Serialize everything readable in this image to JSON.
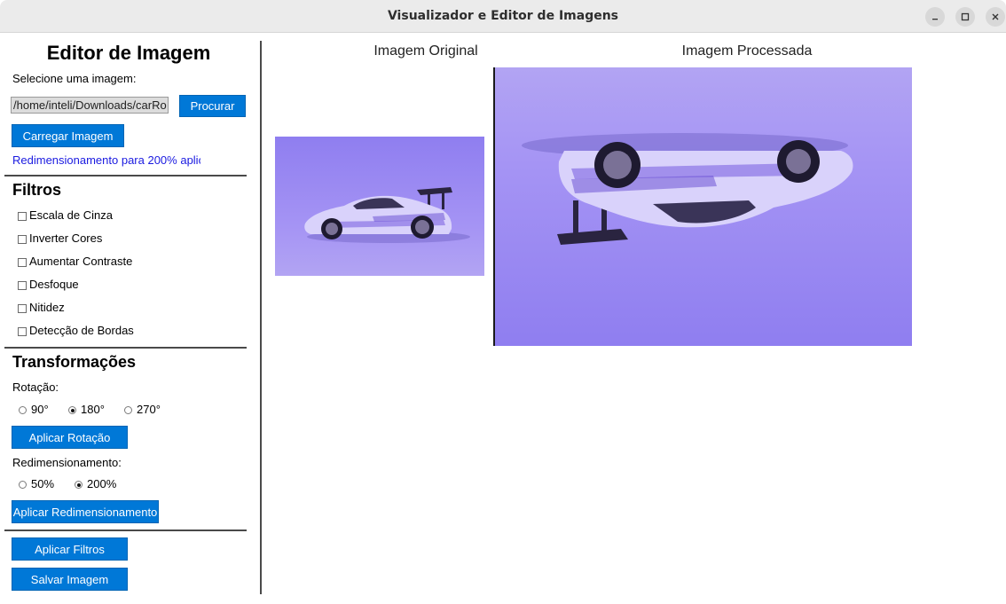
{
  "window": {
    "title": "Visualizador e Editor de Imagens"
  },
  "sidebar": {
    "heading": "Editor de Imagem",
    "select_label": "Selecione uma imagem:",
    "path_value": "/home/inteli/Downloads/carRo",
    "browse_label": "Procurar",
    "load_label": "Carregar Imagem",
    "status_text": "Redimensionamento para 200% aplic",
    "filters": {
      "heading": "Filtros",
      "items": [
        {
          "label": "Escala de Cinza",
          "checked": false
        },
        {
          "label": "Inverter Cores",
          "checked": false
        },
        {
          "label": "Aumentar Contraste",
          "checked": false
        },
        {
          "label": "Desfoque",
          "checked": false
        },
        {
          "label": "Nitidez",
          "checked": false
        },
        {
          "label": "Detecção de Bordas",
          "checked": false
        }
      ]
    },
    "transforms": {
      "heading": "Transformações",
      "rotation_label": "Rotação:",
      "rotation_options": [
        {
          "label": "90°",
          "selected": false
        },
        {
          "label": "180°",
          "selected": true
        },
        {
          "label": "270°",
          "selected": false
        }
      ],
      "apply_rotation_label": "Aplicar Rotação",
      "resize_label": "Redimensionamento:",
      "resize_options": [
        {
          "label": "50%",
          "selected": false
        },
        {
          "label": "200%",
          "selected": true
        }
      ],
      "apply_resize_label": "Aplicar Redimensionamento"
    },
    "apply_filters_label": "Aplicar Filtros",
    "save_label": "Salvar Imagem"
  },
  "viewer": {
    "original_label": "Imagem Original",
    "processed_label": "Imagem Processada"
  },
  "colors": {
    "accent": "#0078d7",
    "status_text": "#1a1ae0",
    "image_background": "#9b86ee"
  }
}
